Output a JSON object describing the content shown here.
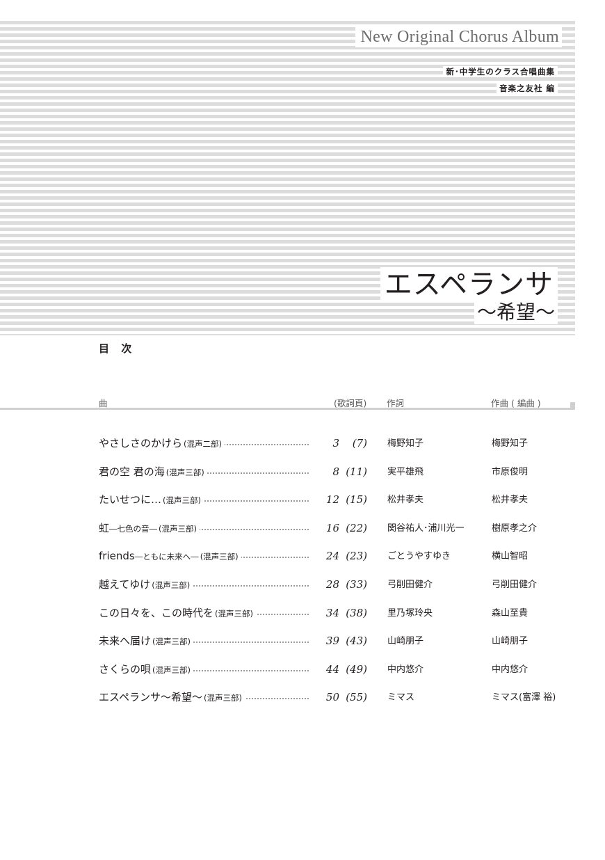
{
  "header": {
    "series": "New Original Chorus Album",
    "subtitle_line1": "新･中学生のクラス合唱曲集",
    "subtitle_line2": "音楽之友社 編",
    "title": "エスペランサ",
    "title_sub": "～希望～"
  },
  "toc": {
    "heading": "目 次",
    "columns": {
      "song": "曲",
      "pages": "(歌詞頁)",
      "lyricist": "作詞",
      "composer": "作曲 ( 編曲 )"
    },
    "rows": [
      {
        "title": "やさしさのかけら",
        "title_sub": "",
        "part": "(混声二部)",
        "page": "3",
        "lyric_page": "(7)",
        "lyricist": "梅野知子",
        "composer": "梅野知子"
      },
      {
        "title": "君の空 君の海",
        "title_sub": "",
        "part": "(混声三部)",
        "page": "8",
        "lyric_page": "(11)",
        "lyricist": "実平雄飛",
        "composer": "市原俊明"
      },
      {
        "title": "たいせつに…",
        "title_sub": "",
        "part": "(混声三部)",
        "page": "12",
        "lyric_page": "(15)",
        "lyricist": "松井孝夫",
        "composer": "松井孝夫"
      },
      {
        "title": "虹",
        "title_sub": "―七色の音―",
        "part": "(混声三部)",
        "page": "16",
        "lyric_page": "(22)",
        "lyricist": "関谷祐人･浦川光一",
        "composer": "樹原孝之介"
      },
      {
        "title": "friends",
        "title_sub": "―ともに未来へ―",
        "part": "(混声三部)",
        "page": "24",
        "lyric_page": "(23)",
        "lyricist": "ごとうやすゆき",
        "composer": "横山智昭"
      },
      {
        "title": "越えてゆけ",
        "title_sub": "",
        "part": "(混声三部)",
        "page": "28",
        "lyric_page": "(33)",
        "lyricist": "弓削田健介",
        "composer": "弓削田健介"
      },
      {
        "title": "この日々を、この時代を",
        "title_sub": "",
        "part": "(混声三部)",
        "page": "34",
        "lyric_page": "(38)",
        "lyricist": "里乃塚玲央",
        "composer": "森山至貴"
      },
      {
        "title": "未来へ届け",
        "title_sub": "",
        "part": "(混声三部)",
        "page": "39",
        "lyric_page": "(43)",
        "lyricist": "山崎朋子",
        "composer": "山崎朋子"
      },
      {
        "title": "さくらの唄",
        "title_sub": "",
        "part": "(混声三部)",
        "page": "44",
        "lyric_page": "(49)",
        "lyricist": "中内悠介",
        "composer": "中内悠介"
      },
      {
        "title": "エスペランサ～希望～",
        "title_sub": "",
        "part": "(混声三部)",
        "page": "50",
        "lyric_page": "(55)",
        "lyricist": "ミマス",
        "composer": "ミマス(富澤 裕)"
      }
    ]
  }
}
